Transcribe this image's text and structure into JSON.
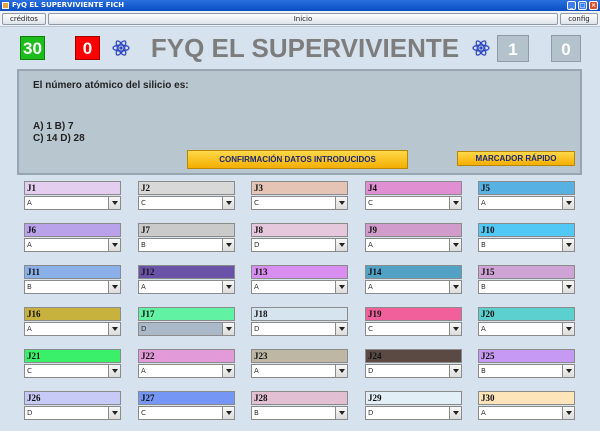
{
  "window": {
    "title": "FyQ EL SUPERVIVIENTE FICH",
    "minimize": "_",
    "maximize": "□",
    "close": "×"
  },
  "menubar": {
    "credits": "créditos",
    "home": "Inicio",
    "config": "config"
  },
  "header": {
    "title": "FYQ EL SUPERVIVIENTE",
    "score_green": "30",
    "score_red": "0",
    "score_right_1": "1",
    "score_right_2": "0",
    "colors": {
      "green": "#1ebd1e",
      "red": "#ff0000",
      "gray_box": "#b4c2cc",
      "title": "#7d7d7d"
    }
  },
  "question": {
    "text": "El número atómico del silicio es:",
    "option_line_1": "A) 1  B) 7",
    "option_line_2": "C) 14  D) 28"
  },
  "buttons": {
    "confirm": "CONFIRMACIÓN DATOS INTRODUCIDOS",
    "quick_score": "MARCADOR RÁPIDO"
  },
  "players": [
    {
      "label": "J1",
      "value": "A",
      "color": "#e3cef0"
    },
    {
      "label": "J2",
      "value": "C",
      "color": "#d8d8d8"
    },
    {
      "label": "J3",
      "value": "C",
      "color": "#e5c4b6"
    },
    {
      "label": "J4",
      "value": "C",
      "color": "#e08fd2"
    },
    {
      "label": "J5",
      "value": "A",
      "color": "#57b1e3"
    },
    {
      "label": "J6",
      "value": "A",
      "color": "#b9a2ea"
    },
    {
      "label": "J7",
      "value": "B",
      "color": "#cacaca"
    },
    {
      "label": "J8",
      "value": "D",
      "color": "#e6c8dc"
    },
    {
      "label": "J9",
      "value": "A",
      "color": "#d19ccc"
    },
    {
      "label": "J10",
      "value": "B",
      "color": "#52c8f7"
    },
    {
      "label": "J11",
      "value": "B",
      "color": "#8ab0ea"
    },
    {
      "label": "J12",
      "value": "A",
      "color": "#6953a9"
    },
    {
      "label": "J13",
      "value": "A",
      "color": "#d88ef0"
    },
    {
      "label": "J14",
      "value": "A",
      "color": "#52a2c6"
    },
    {
      "label": "J15",
      "value": "B",
      "color": "#d0a3d6"
    },
    {
      "label": "J16",
      "value": "A",
      "color": "#c6b23c"
    },
    {
      "label": "J17",
      "value": "D",
      "color": "#61f3a3"
    },
    {
      "label": "J18",
      "value": "D",
      "color": "#d5e4ef"
    },
    {
      "label": "J19",
      "value": "C",
      "color": "#f2609c"
    },
    {
      "label": "J20",
      "value": "A",
      "color": "#5ccfcf"
    },
    {
      "label": "J21",
      "value": "C",
      "color": "#3af06b"
    },
    {
      "label": "J22",
      "value": "A",
      "color": "#e39ad9"
    },
    {
      "label": "J23",
      "value": "A",
      "color": "#bdb7a3"
    },
    {
      "label": "J24",
      "value": "D",
      "color": "#5b4a44"
    },
    {
      "label": "J25",
      "value": "B",
      "color": "#c69af4"
    },
    {
      "label": "J26",
      "value": "D",
      "color": "#c7c9f6"
    },
    {
      "label": "J27",
      "value": "C",
      "color": "#7596f4"
    },
    {
      "label": "J28",
      "value": "B",
      "color": "#e3bfd3"
    },
    {
      "label": "J29",
      "value": "D",
      "color": "#e2eff6"
    },
    {
      "label": "J30",
      "value": "A",
      "color": "#fde5b9"
    }
  ]
}
